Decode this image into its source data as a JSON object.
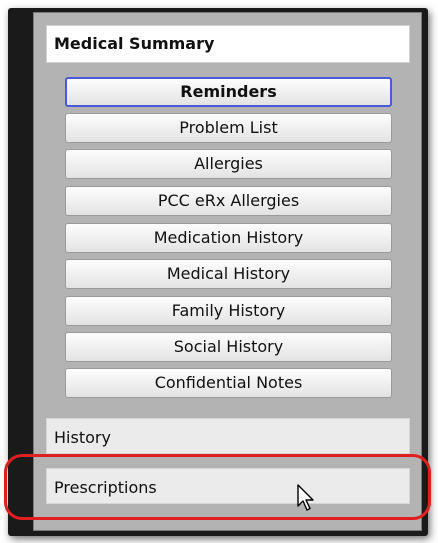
{
  "panel": {
    "title": "Medical Summary",
    "buttons": [
      {
        "label": "Reminders",
        "active": true
      },
      {
        "label": "Problem List",
        "active": false
      },
      {
        "label": "Allergies",
        "active": false
      },
      {
        "label": "PCC eRx Allergies",
        "active": false
      },
      {
        "label": "Medication History",
        "active": false
      },
      {
        "label": "Medical History",
        "active": false
      },
      {
        "label": "Family History",
        "active": false
      },
      {
        "label": "Social History",
        "active": false
      },
      {
        "label": "Confidential Notes",
        "active": false
      }
    ],
    "sections": [
      {
        "label": "History"
      },
      {
        "label": "Prescriptions"
      }
    ]
  },
  "colors": {
    "panel_bg": "#b3b3b3",
    "active_border": "#4a5ad8",
    "highlight": "#e0201e"
  },
  "icons": {
    "cursor": "mouse-pointer-icon"
  }
}
